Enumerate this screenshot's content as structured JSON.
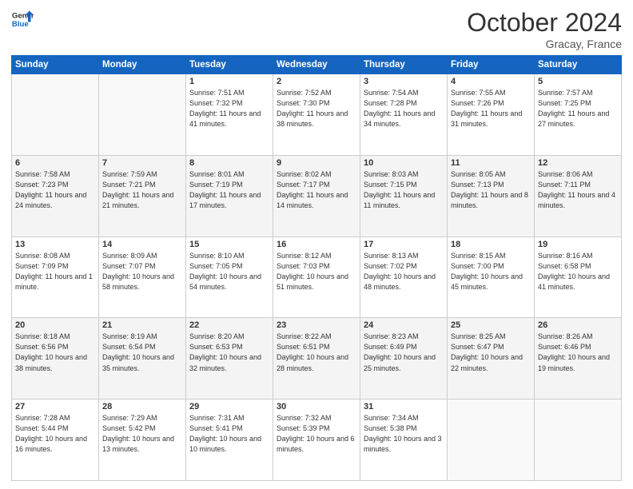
{
  "header": {
    "logo_line1": "General",
    "logo_line2": "Blue",
    "month": "October 2024",
    "location": "Gracay, France"
  },
  "weekdays": [
    "Sunday",
    "Monday",
    "Tuesday",
    "Wednesday",
    "Thursday",
    "Friday",
    "Saturday"
  ],
  "weeks": [
    [
      {
        "day": "",
        "info": ""
      },
      {
        "day": "",
        "info": ""
      },
      {
        "day": "1",
        "info": "Sunrise: 7:51 AM\nSunset: 7:32 PM\nDaylight: 11 hours and 41 minutes."
      },
      {
        "day": "2",
        "info": "Sunrise: 7:52 AM\nSunset: 7:30 PM\nDaylight: 11 hours and 38 minutes."
      },
      {
        "day": "3",
        "info": "Sunrise: 7:54 AM\nSunset: 7:28 PM\nDaylight: 11 hours and 34 minutes."
      },
      {
        "day": "4",
        "info": "Sunrise: 7:55 AM\nSunset: 7:26 PM\nDaylight: 11 hours and 31 minutes."
      },
      {
        "day": "5",
        "info": "Sunrise: 7:57 AM\nSunset: 7:25 PM\nDaylight: 11 hours and 27 minutes."
      }
    ],
    [
      {
        "day": "6",
        "info": "Sunrise: 7:58 AM\nSunset: 7:23 PM\nDaylight: 11 hours and 24 minutes."
      },
      {
        "day": "7",
        "info": "Sunrise: 7:59 AM\nSunset: 7:21 PM\nDaylight: 11 hours and 21 minutes."
      },
      {
        "day": "8",
        "info": "Sunrise: 8:01 AM\nSunset: 7:19 PM\nDaylight: 11 hours and 17 minutes."
      },
      {
        "day": "9",
        "info": "Sunrise: 8:02 AM\nSunset: 7:17 PM\nDaylight: 11 hours and 14 minutes."
      },
      {
        "day": "10",
        "info": "Sunrise: 8:03 AM\nSunset: 7:15 PM\nDaylight: 11 hours and 11 minutes."
      },
      {
        "day": "11",
        "info": "Sunrise: 8:05 AM\nSunset: 7:13 PM\nDaylight: 11 hours and 8 minutes."
      },
      {
        "day": "12",
        "info": "Sunrise: 8:06 AM\nSunset: 7:11 PM\nDaylight: 11 hours and 4 minutes."
      }
    ],
    [
      {
        "day": "13",
        "info": "Sunrise: 8:08 AM\nSunset: 7:09 PM\nDaylight: 11 hours and 1 minute."
      },
      {
        "day": "14",
        "info": "Sunrise: 8:09 AM\nSunset: 7:07 PM\nDaylight: 10 hours and 58 minutes."
      },
      {
        "day": "15",
        "info": "Sunrise: 8:10 AM\nSunset: 7:05 PM\nDaylight: 10 hours and 54 minutes."
      },
      {
        "day": "16",
        "info": "Sunrise: 8:12 AM\nSunset: 7:03 PM\nDaylight: 10 hours and 51 minutes."
      },
      {
        "day": "17",
        "info": "Sunrise: 8:13 AM\nSunset: 7:02 PM\nDaylight: 10 hours and 48 minutes."
      },
      {
        "day": "18",
        "info": "Sunrise: 8:15 AM\nSunset: 7:00 PM\nDaylight: 10 hours and 45 minutes."
      },
      {
        "day": "19",
        "info": "Sunrise: 8:16 AM\nSunset: 6:58 PM\nDaylight: 10 hours and 41 minutes."
      }
    ],
    [
      {
        "day": "20",
        "info": "Sunrise: 8:18 AM\nSunset: 6:56 PM\nDaylight: 10 hours and 38 minutes."
      },
      {
        "day": "21",
        "info": "Sunrise: 8:19 AM\nSunset: 6:54 PM\nDaylight: 10 hours and 35 minutes."
      },
      {
        "day": "22",
        "info": "Sunrise: 8:20 AM\nSunset: 6:53 PM\nDaylight: 10 hours and 32 minutes."
      },
      {
        "day": "23",
        "info": "Sunrise: 8:22 AM\nSunset: 6:51 PM\nDaylight: 10 hours and 28 minutes."
      },
      {
        "day": "24",
        "info": "Sunrise: 8:23 AM\nSunset: 6:49 PM\nDaylight: 10 hours and 25 minutes."
      },
      {
        "day": "25",
        "info": "Sunrise: 8:25 AM\nSunset: 6:47 PM\nDaylight: 10 hours and 22 minutes."
      },
      {
        "day": "26",
        "info": "Sunrise: 8:26 AM\nSunset: 6:46 PM\nDaylight: 10 hours and 19 minutes."
      }
    ],
    [
      {
        "day": "27",
        "info": "Sunrise: 7:28 AM\nSunset: 5:44 PM\nDaylight: 10 hours and 16 minutes."
      },
      {
        "day": "28",
        "info": "Sunrise: 7:29 AM\nSunset: 5:42 PM\nDaylight: 10 hours and 13 minutes."
      },
      {
        "day": "29",
        "info": "Sunrise: 7:31 AM\nSunset: 5:41 PM\nDaylight: 10 hours and 10 minutes."
      },
      {
        "day": "30",
        "info": "Sunrise: 7:32 AM\nSunset: 5:39 PM\nDaylight: 10 hours and 6 minutes."
      },
      {
        "day": "31",
        "info": "Sunrise: 7:34 AM\nSunset: 5:38 PM\nDaylight: 10 hours and 3 minutes."
      },
      {
        "day": "",
        "info": ""
      },
      {
        "day": "",
        "info": ""
      }
    ]
  ]
}
